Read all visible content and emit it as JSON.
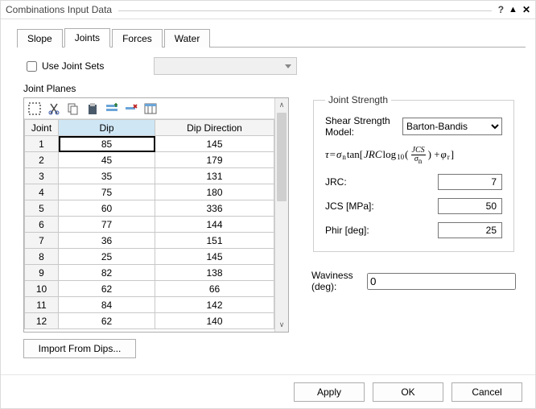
{
  "title": "Combinations Input Data",
  "tabs": [
    "Slope",
    "Joints",
    "Forces",
    "Water"
  ],
  "active_tab": 1,
  "use_joint_sets_label": "Use Joint Sets",
  "use_joint_sets_checked": false,
  "joint_planes_label": "Joint Planes",
  "table": {
    "headers": {
      "joint": "Joint",
      "dip": "Dip",
      "dipdir": "Dip Direction"
    },
    "rows": [
      {
        "n": "1",
        "dip": "85",
        "dir": "145"
      },
      {
        "n": "2",
        "dip": "45",
        "dir": "179"
      },
      {
        "n": "3",
        "dip": "35",
        "dir": "131"
      },
      {
        "n": "4",
        "dip": "75",
        "dir": "180"
      },
      {
        "n": "5",
        "dip": "60",
        "dir": "336"
      },
      {
        "n": "6",
        "dip": "77",
        "dir": "144"
      },
      {
        "n": "7",
        "dip": "36",
        "dir": "151"
      },
      {
        "n": "8",
        "dip": "25",
        "dir": "145"
      },
      {
        "n": "9",
        "dip": "82",
        "dir": "138"
      },
      {
        "n": "10",
        "dip": "62",
        "dir": "66"
      },
      {
        "n": "11",
        "dip": "84",
        "dir": "142"
      },
      {
        "n": "12",
        "dip": "62",
        "dir": "140"
      }
    ],
    "selected_row": 0,
    "selected_col": "dip"
  },
  "import_label": "Import From Dips...",
  "joint_strength": {
    "legend": "Joint Strength",
    "model_label": "Shear Strength Model:",
    "model_value": "Barton-Bandis",
    "jrc_label": "JRC:",
    "jrc_value": "7",
    "jcs_label": "JCS [MPa]:",
    "jcs_value": "50",
    "phir_label": "Phir [deg]:",
    "phir_value": "25"
  },
  "waviness": {
    "label": "Waviness (deg):",
    "value": "0"
  },
  "footer": {
    "apply": "Apply",
    "ok": "OK",
    "cancel": "Cancel"
  },
  "toolbar_icons": [
    "select-icon",
    "cut-icon",
    "copy-icon",
    "paste-icon",
    "insert-row-icon",
    "delete-row-icon",
    "columns-icon"
  ]
}
